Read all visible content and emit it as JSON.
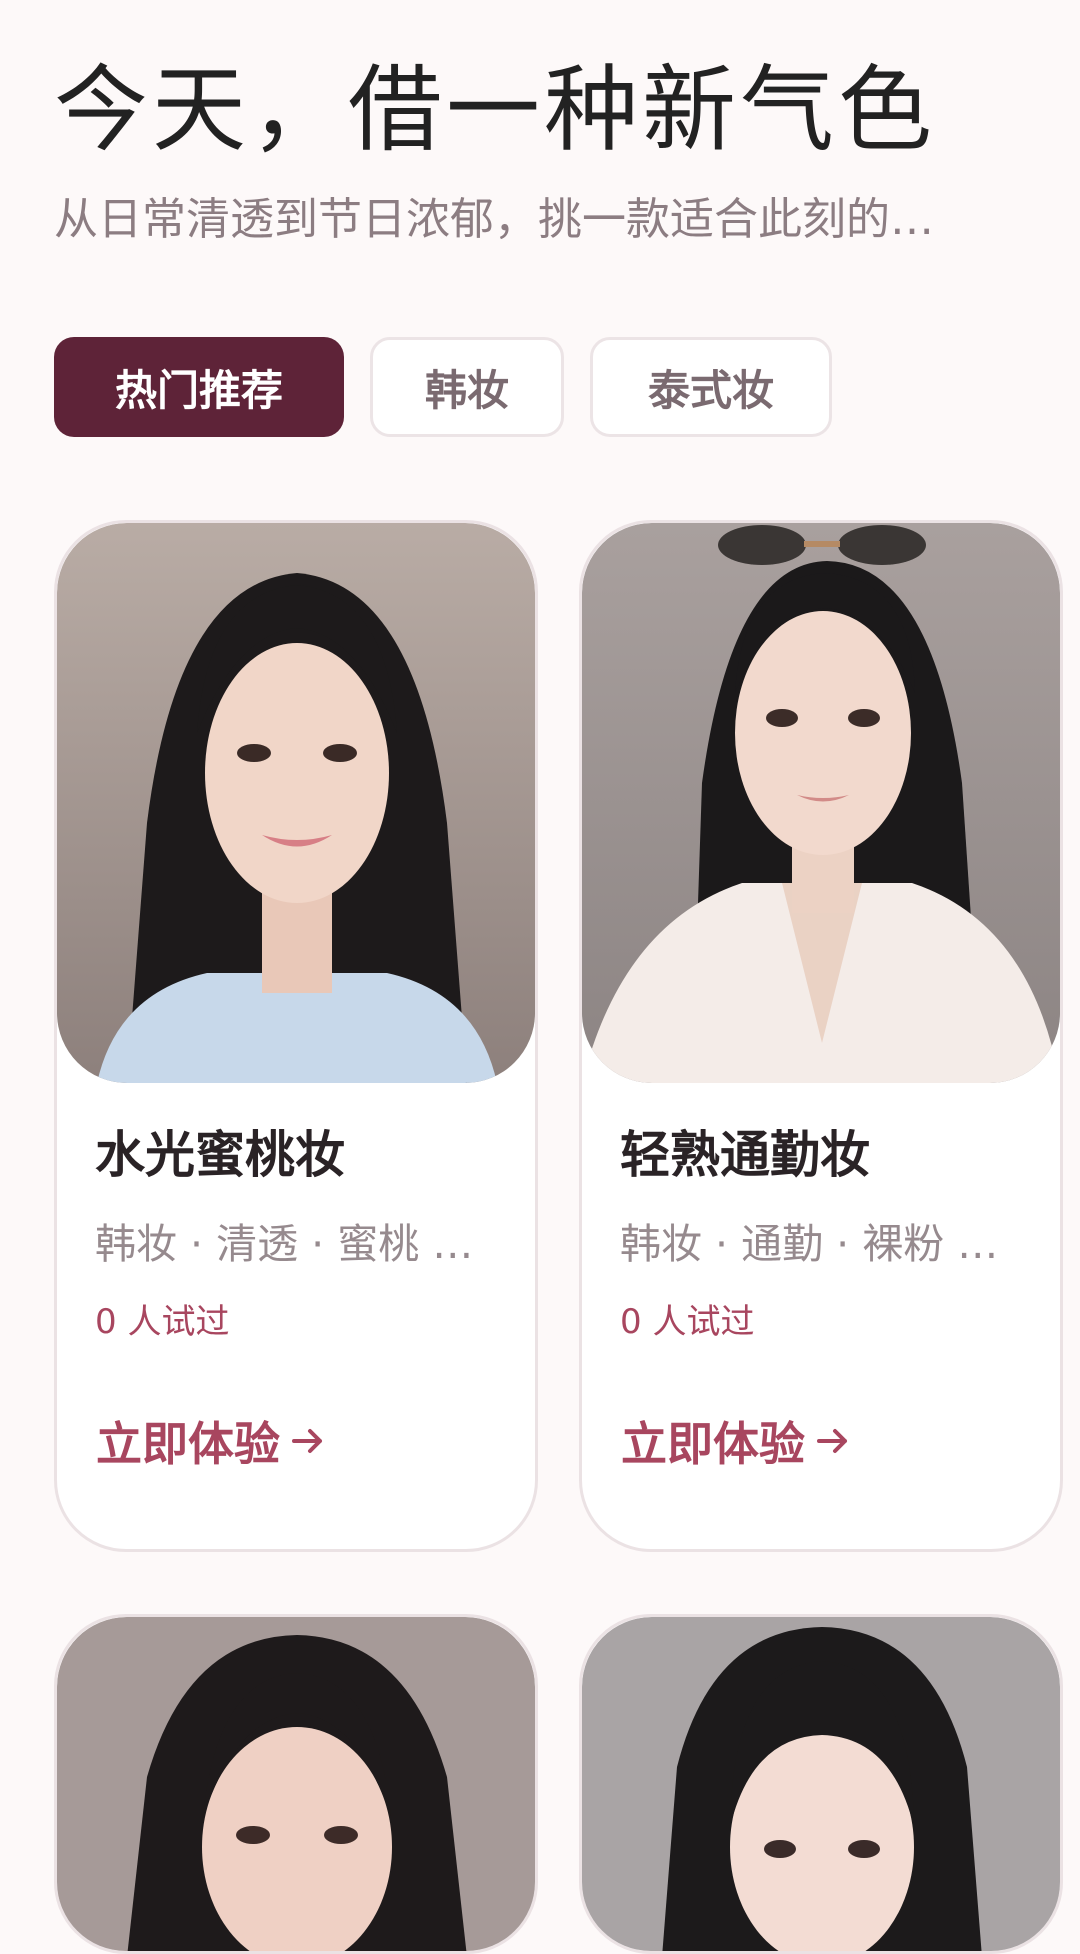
{
  "header": {
    "title": "今天，借一种新气色",
    "subtitle": "从日常清透到节日浓郁，挑一款适合此刻的…"
  },
  "tabs": [
    {
      "label": "热门推荐",
      "active": true
    },
    {
      "label": "韩妆",
      "active": false
    },
    {
      "label": "泰式妆",
      "active": false
    }
  ],
  "cards": [
    {
      "title": "水光蜜桃妆",
      "tags": "韩妆 · 清透 · 蜜桃 …",
      "tried": "0 人试过",
      "cta": "立即体验",
      "cta_icon": "arrow-right-icon"
    },
    {
      "title": "轻熟通勤妆",
      "tags": "韩妆 · 通勤 · 裸粉 …",
      "tried": "0 人试过",
      "cta": "立即体验",
      "cta_icon": "arrow-right-icon"
    },
    {},
    {}
  ],
  "colors": {
    "accent": "#5e2338",
    "highlight": "#a8465f",
    "background": "#fdf9f9"
  }
}
